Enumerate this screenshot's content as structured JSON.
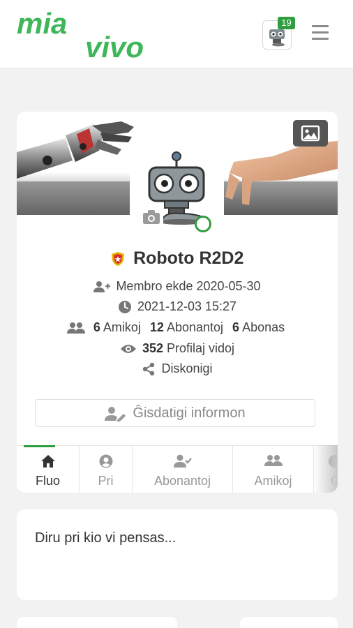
{
  "header": {
    "logo_text": "mia vivo",
    "notification_count": "19"
  },
  "profile": {
    "name": "Roboto R2D2",
    "member_since": "Membro ekde 2020-05-30",
    "last_seen": "2021-12-03 15:27",
    "stats": {
      "friends_count": "6",
      "friends_label": "Amikoj",
      "followers_count": "12",
      "followers_label": "Abonantoj",
      "following_count": "6",
      "following_label": "Abonas"
    },
    "views_count": "352",
    "views_label": "Profilaj vidoj",
    "share_label": "Diskonigi",
    "edit_button": "Ĝisdatigi informon"
  },
  "tabs": [
    {
      "label": "Fluo",
      "icon": "home-icon",
      "active": true
    },
    {
      "label": "Pri",
      "icon": "user-circle-icon",
      "active": false
    },
    {
      "label": "Abonantoj",
      "icon": "user-check-icon",
      "active": false
    },
    {
      "label": "Amikoj",
      "icon": "users-icon",
      "active": false
    },
    {
      "label": "G",
      "icon": "group-icon",
      "active": false
    }
  ],
  "composer": {
    "placeholder": "Diru pri kio vi pensas..."
  },
  "colors": {
    "accent": "#2e9e3e",
    "logo": "#3fb65a"
  }
}
